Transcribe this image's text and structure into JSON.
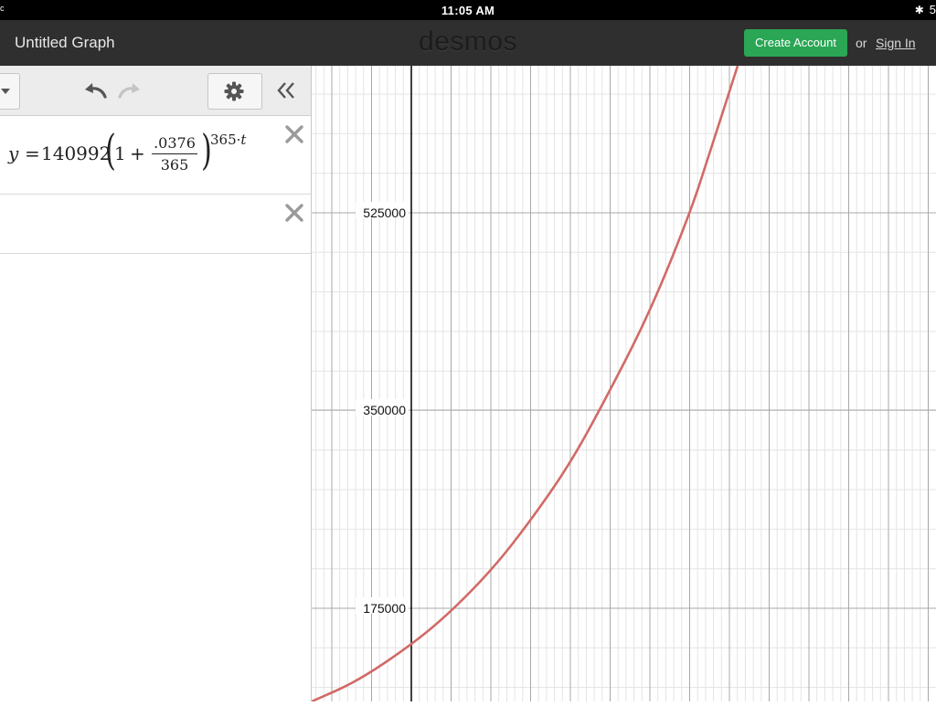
{
  "status_bar": {
    "time": "11:05 AM",
    "left_glyph": "ᶜ",
    "battery": "5"
  },
  "header": {
    "graph_title": "Untitled Graph",
    "logo": "desmos",
    "create_account_label": "Create Account",
    "or_label": "or",
    "sign_in_label": "Sign In",
    "accent_color": "#2aa655"
  },
  "toolbar": {
    "icons": [
      "dropdown-caret-icon",
      "undo-icon",
      "redo-icon",
      "gear-icon",
      "double-chevron-left-icon"
    ]
  },
  "expressions": [
    {
      "lhs": "y",
      "equals": "=",
      "coefficient": "140992",
      "one": "1",
      "plus": "+",
      "frac_num": ".0376",
      "frac_den": "365",
      "exponent_num": "365",
      "exponent_dot": "·",
      "exponent_var": "t",
      "color": "#c74440"
    },
    {
      "lhs": "",
      "color": ""
    }
  ],
  "graph": {
    "y_tick_labels": [
      "525000",
      "350000",
      "175000"
    ],
    "curve_color": "#d16a66"
  }
}
